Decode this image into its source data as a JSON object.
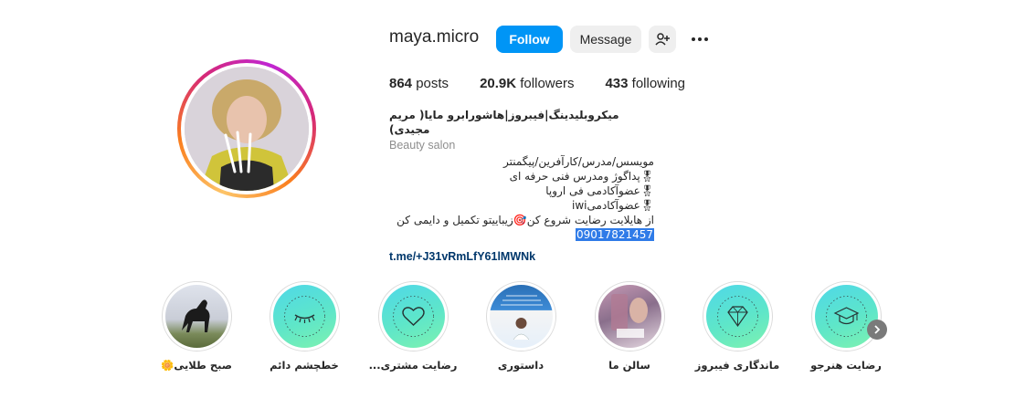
{
  "profile": {
    "username": "maya.micro",
    "follow_label": "Follow",
    "message_label": "Message",
    "add_user_icon": "person-plus-icon",
    "more_icon": "more-horizontal-icon"
  },
  "stats": {
    "posts_count": "864",
    "posts_label": "posts",
    "followers_count": "20.9K",
    "followers_label": "followers",
    "following_count": "433",
    "following_label": "following"
  },
  "bio": {
    "name": "میکروبلیدینگ|فیبروز|هاشورابرو مایا( مریم مجیدی)",
    "category": "Beauty salon",
    "lines": [
      "مویسس/مدرس/کارآفرین/پیگمنتر",
      "🎖پداگوژ ومدرس فنی حرفه ای",
      "🎖عضوآکادمی فی اروپا",
      "🎖عضوآکادمیiwi",
      "از هایلایت رضایت شروع کن🎯زیباییتو تکمیل و دایمی کن"
    ],
    "phone": "09017821457",
    "link": "t.me/+J31vRmLfY61lMWNk"
  },
  "highlights": [
    {
      "label": "صبح طلایی🌼",
      "icon": "horse-photo"
    },
    {
      "label": "خطچشم دائم",
      "icon": "eyelash-icon"
    },
    {
      "label": "رضایت مشتری...",
      "icon": "heart-icon"
    },
    {
      "label": "داستوری",
      "icon": "document-photo"
    },
    {
      "label": "سالن ما",
      "icon": "salon-photo"
    },
    {
      "label": "ماندگاری فیبروز",
      "icon": "diamond-icon"
    },
    {
      "label": "رضایت هنرجو",
      "icon": "graduation-cap-icon"
    }
  ],
  "navigation": {
    "next_icon": "chevron-right-icon"
  }
}
